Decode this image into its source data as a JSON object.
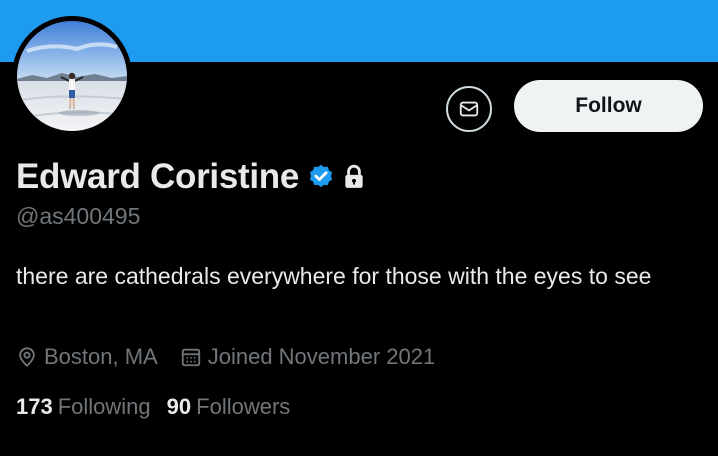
{
  "colors": {
    "banner": "#1d9bf0",
    "background": "#000000",
    "primary_text": "#e7e9ea",
    "secondary_text": "#71767b",
    "verified": "#1d9bf0",
    "follow_button_bg": "#eff3f4"
  },
  "profile": {
    "name": "Edward Coristine",
    "handle": "@as400495",
    "verified_icon": "verified-badge-icon",
    "protected_icon": "lock-icon",
    "bio": "there are cathedrals everywhere for those with the eyes to see"
  },
  "actions": {
    "message_icon": "message-icon",
    "follow_label": "Follow"
  },
  "meta": {
    "location": "Boston, MA",
    "location_icon": "location-pin-icon",
    "joined": "Joined November 2021",
    "joined_icon": "calendar-icon"
  },
  "stats": {
    "following_count": "173",
    "following_label": "Following",
    "followers_count": "90",
    "followers_label": "Followers"
  }
}
